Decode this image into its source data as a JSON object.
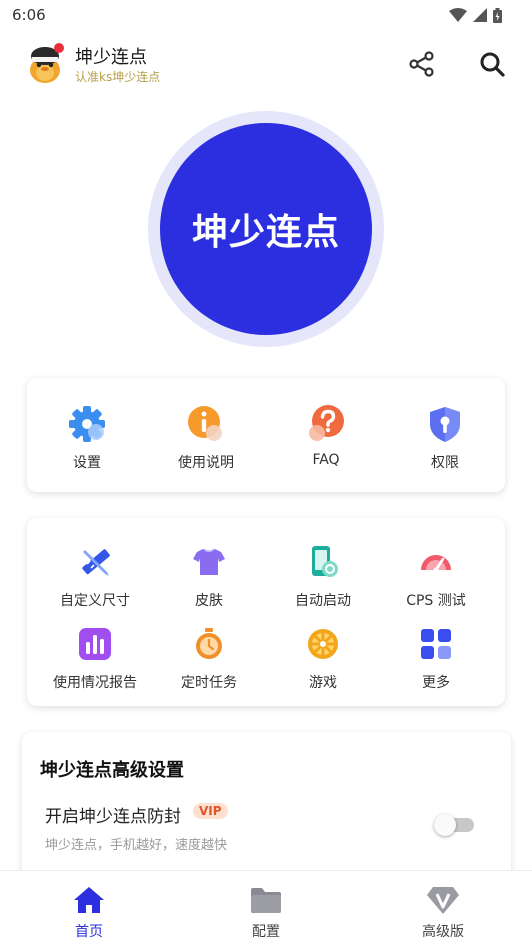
{
  "status_bar": {
    "time": "6:06"
  },
  "header": {
    "title": "坤少连点",
    "subtitle": "认准ks坤少连点",
    "share_icon": "share-icon",
    "search_icon": "search-icon"
  },
  "main_button": {
    "label": "坤少连点",
    "color": "#2b2fe0"
  },
  "quick_menu": [
    {
      "label": "设置",
      "icon": "gear-icon"
    },
    {
      "label": "使用说明",
      "icon": "info-icon"
    },
    {
      "label": "FAQ",
      "icon": "question-icon"
    },
    {
      "label": "权限",
      "icon": "shield-key-icon"
    }
  ],
  "tools_menu": [
    {
      "label": "自定义尺寸",
      "icon": "ruler-pencil-icon"
    },
    {
      "label": "皮肤",
      "icon": "tshirt-icon"
    },
    {
      "label": "自动启动",
      "icon": "phone-link-icon"
    },
    {
      "label": "CPS 测试",
      "icon": "speedometer-icon"
    },
    {
      "label": "使用情况报告",
      "icon": "bar-chart-icon"
    },
    {
      "label": "定时任务",
      "icon": "stopwatch-icon"
    },
    {
      "label": "游戏",
      "icon": "game-wheel-icon"
    },
    {
      "label": "更多",
      "icon": "grid-more-icon"
    }
  ],
  "advanced": {
    "title": "坤少连点高级设置",
    "option_label": "开启坤少连点防封",
    "badge": "VIP",
    "option_desc": "坤少连点，手机越好，速度越快",
    "toggle_on": false
  },
  "bottom_nav": [
    {
      "label": "首页",
      "icon": "home-icon",
      "active": true
    },
    {
      "label": "配置",
      "icon": "folder-icon",
      "active": false
    },
    {
      "label": "高级版",
      "icon": "vip-diamond-icon",
      "active": false
    }
  ]
}
